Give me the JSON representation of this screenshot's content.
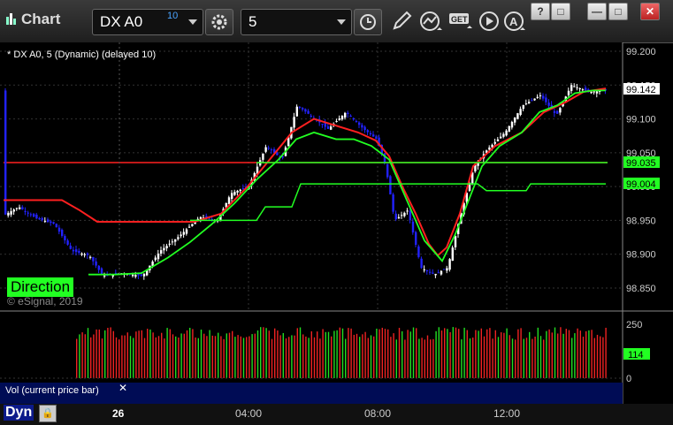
{
  "window": {
    "title": "Chart"
  },
  "toolbar": {
    "symbol": "DX A0",
    "symbol_badge": "10",
    "interval": "5"
  },
  "window_controls": {
    "help": "?",
    "restore": "□",
    "minimize": "—",
    "maximize": "□",
    "close": "✕"
  },
  "chart": {
    "legend": "* DX A0, 5 (Dynamic) (delayed 10)",
    "direction_label": "Direction",
    "copyright": "© eSignal, 2019",
    "price_axis": [
      "99.200",
      "99.150",
      "99.100",
      "99.050",
      "99.000",
      "98.950",
      "98.900",
      "98.850"
    ],
    "last_price": "99.142",
    "green_level": "99.035",
    "upper_level_line": "99.004",
    "colors": {
      "up": "#ffffff",
      "down": "#2222ff",
      "red_line": "#ff2020",
      "green_line": "#22ff22"
    }
  },
  "volume": {
    "label": "Vol (current price bar)",
    "close_glyph": "✕",
    "axis": [
      "250",
      "0"
    ],
    "last_value": "114"
  },
  "bottom": {
    "mode": "Dyn",
    "date": "26",
    "times": [
      "04:00",
      "08:00",
      "12:00"
    ]
  }
}
